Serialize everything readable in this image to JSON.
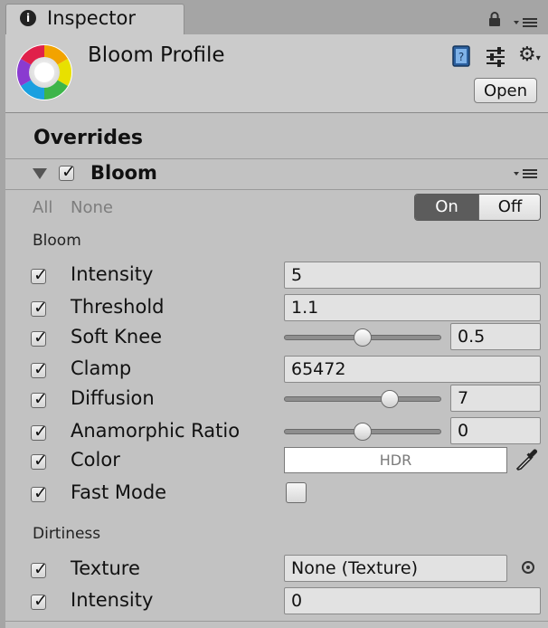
{
  "tab": {
    "title": "Inspector",
    "icon": "info-icon"
  },
  "header": {
    "title": "Bloom Profile",
    "open_label": "Open",
    "icons": [
      "camera-aperture-icon",
      "book-icon",
      "presets-icon",
      "gear-icon"
    ]
  },
  "overrides": {
    "title": "Overrides"
  },
  "effect": {
    "name": "Bloom",
    "enabled": true,
    "all_label": "All",
    "none_label": "None",
    "toggle": {
      "on_label": "On",
      "off_label": "Off",
      "selected": "On"
    }
  },
  "sections": {
    "bloom": {
      "title": "Bloom",
      "rows": [
        {
          "label": "Intensity",
          "value": "5",
          "type": "field"
        },
        {
          "label": "Threshold",
          "value": "1.1",
          "type": "field"
        },
        {
          "label": "Soft Knee",
          "value": "0.5",
          "type": "slider",
          "fraction": 0.5
        },
        {
          "label": "Clamp",
          "value": "65472",
          "type": "field"
        },
        {
          "label": "Diffusion",
          "value": "7",
          "type": "slider",
          "fraction": 0.67
        },
        {
          "label": "Anamorphic Ratio",
          "value": "0",
          "type": "slider",
          "fraction": 0.5
        },
        {
          "label": "Color",
          "value": "HDR",
          "type": "color",
          "color": "#ffffff"
        },
        {
          "label": "Fast Mode",
          "value": "",
          "type": "checkbox",
          "checked": false
        }
      ]
    },
    "dirtiness": {
      "title": "Dirtiness",
      "rows": [
        {
          "label": "Texture",
          "value": "None (Texture)",
          "type": "object"
        },
        {
          "label": "Intensity",
          "value": "0",
          "type": "field"
        }
      ]
    }
  },
  "colors": {
    "panel": "#c2c2c2",
    "header": "#cbcbcb",
    "toggle_on": "#5c5c5c"
  }
}
